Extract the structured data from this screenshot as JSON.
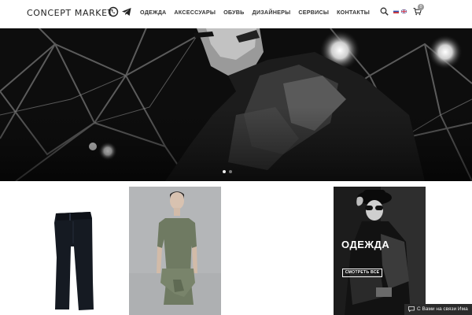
{
  "header": {
    "logo": "CONCEPT MARKET",
    "social": [
      {
        "icon": "whatsapp-icon"
      },
      {
        "icon": "telegram-icon"
      }
    ],
    "nav": [
      {
        "label": "ОДЕЖДА"
      },
      {
        "label": "АКСЕССУАРЫ"
      },
      {
        "label": "ОБУВЬ"
      },
      {
        "label": "ДИЗАЙНЕРЫ"
      },
      {
        "label": "СЕРВИСЫ"
      },
      {
        "label": "КОНТАКТЫ"
      }
    ],
    "icons": {
      "search": "search-icon",
      "cart": "cart-icon"
    },
    "languages": [
      "ru-flag",
      "en-flag"
    ],
    "cart_count": "0"
  },
  "hero": {
    "slides_count": 2,
    "active_slide": 1
  },
  "tiles": {
    "promo": {
      "title": "ОДЕЖДА",
      "button": "СМОТРЕТЬ ВСЕ"
    }
  },
  "chat": {
    "label": "С Вами на связи Има"
  },
  "colors": {
    "background": "#ffffff",
    "text": "#333333",
    "hero_bg": "#0c0c0c",
    "chat_bg": "#2b2b2b"
  }
}
